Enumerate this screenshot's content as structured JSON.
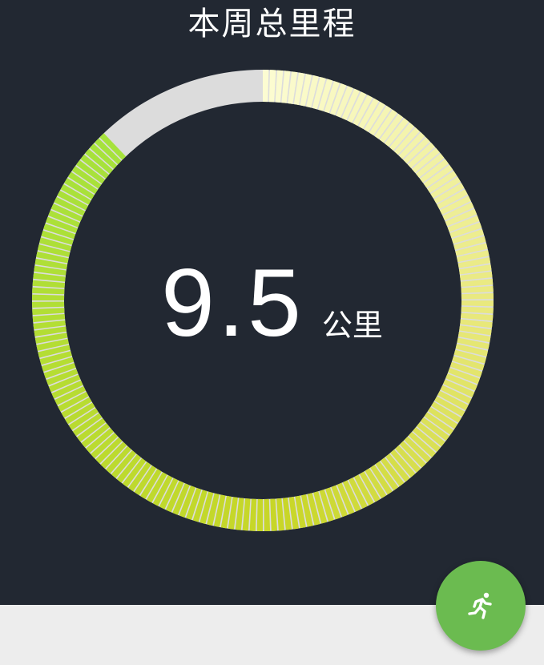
{
  "header": {
    "title": "本周总里程"
  },
  "summary": {
    "distance_value": "9.5",
    "distance_unit": "公里",
    "progress_fraction": 0.88
  },
  "colors": {
    "background": "#222832",
    "track": "#dcdcdc",
    "gradient_start": "#fcfcd2",
    "gradient_mid": "#e8e87a",
    "gradient_bottom": "#c8d628",
    "gradient_end": "#a6e23c",
    "fab": "#6bbb50"
  },
  "fab": {
    "icon": "running-person-icon"
  }
}
